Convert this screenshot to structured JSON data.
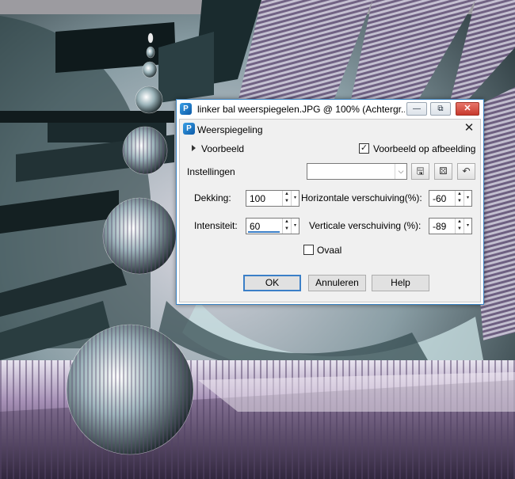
{
  "window": {
    "title": "linker bal weerspiegelen.JPG @ 100% (Achtergr...",
    "minimize_glyph": "—",
    "restore_glyph": "⧉",
    "close_glyph": "✕"
  },
  "dialog": {
    "title": "Weerspiegeling",
    "close_glyph": "✕",
    "preview_label": "Voorbeeld",
    "preview_on_image_label": "Voorbeeld op afbeelding",
    "preview_on_image_checked": true,
    "settings_label": "Instellingen",
    "preset_value": "",
    "fields": {
      "opacity_label": "Dekking:",
      "opacity_value": "100",
      "intensity_label": "Intensiteit:",
      "intensity_value": "60",
      "horizontal_offset_label": "Horizontale verschuiving(%):",
      "horizontal_offset_value": "-60",
      "vertical_offset_label": "Verticale verschuiving (%):",
      "vertical_offset_value": "-89"
    },
    "oval_label": "Ovaal",
    "oval_checked": false,
    "buttons": {
      "ok": "OK",
      "cancel": "Annuleren",
      "help": "Help"
    }
  },
  "icons": {
    "app": "paintshop-pro-icon",
    "save": "save-preset-icon",
    "randomize": "randomize-dice-icon",
    "reset": "reset-default-icon",
    "dropdown": "chevron-down-icon",
    "spinner": "spin-arrows-icon"
  }
}
